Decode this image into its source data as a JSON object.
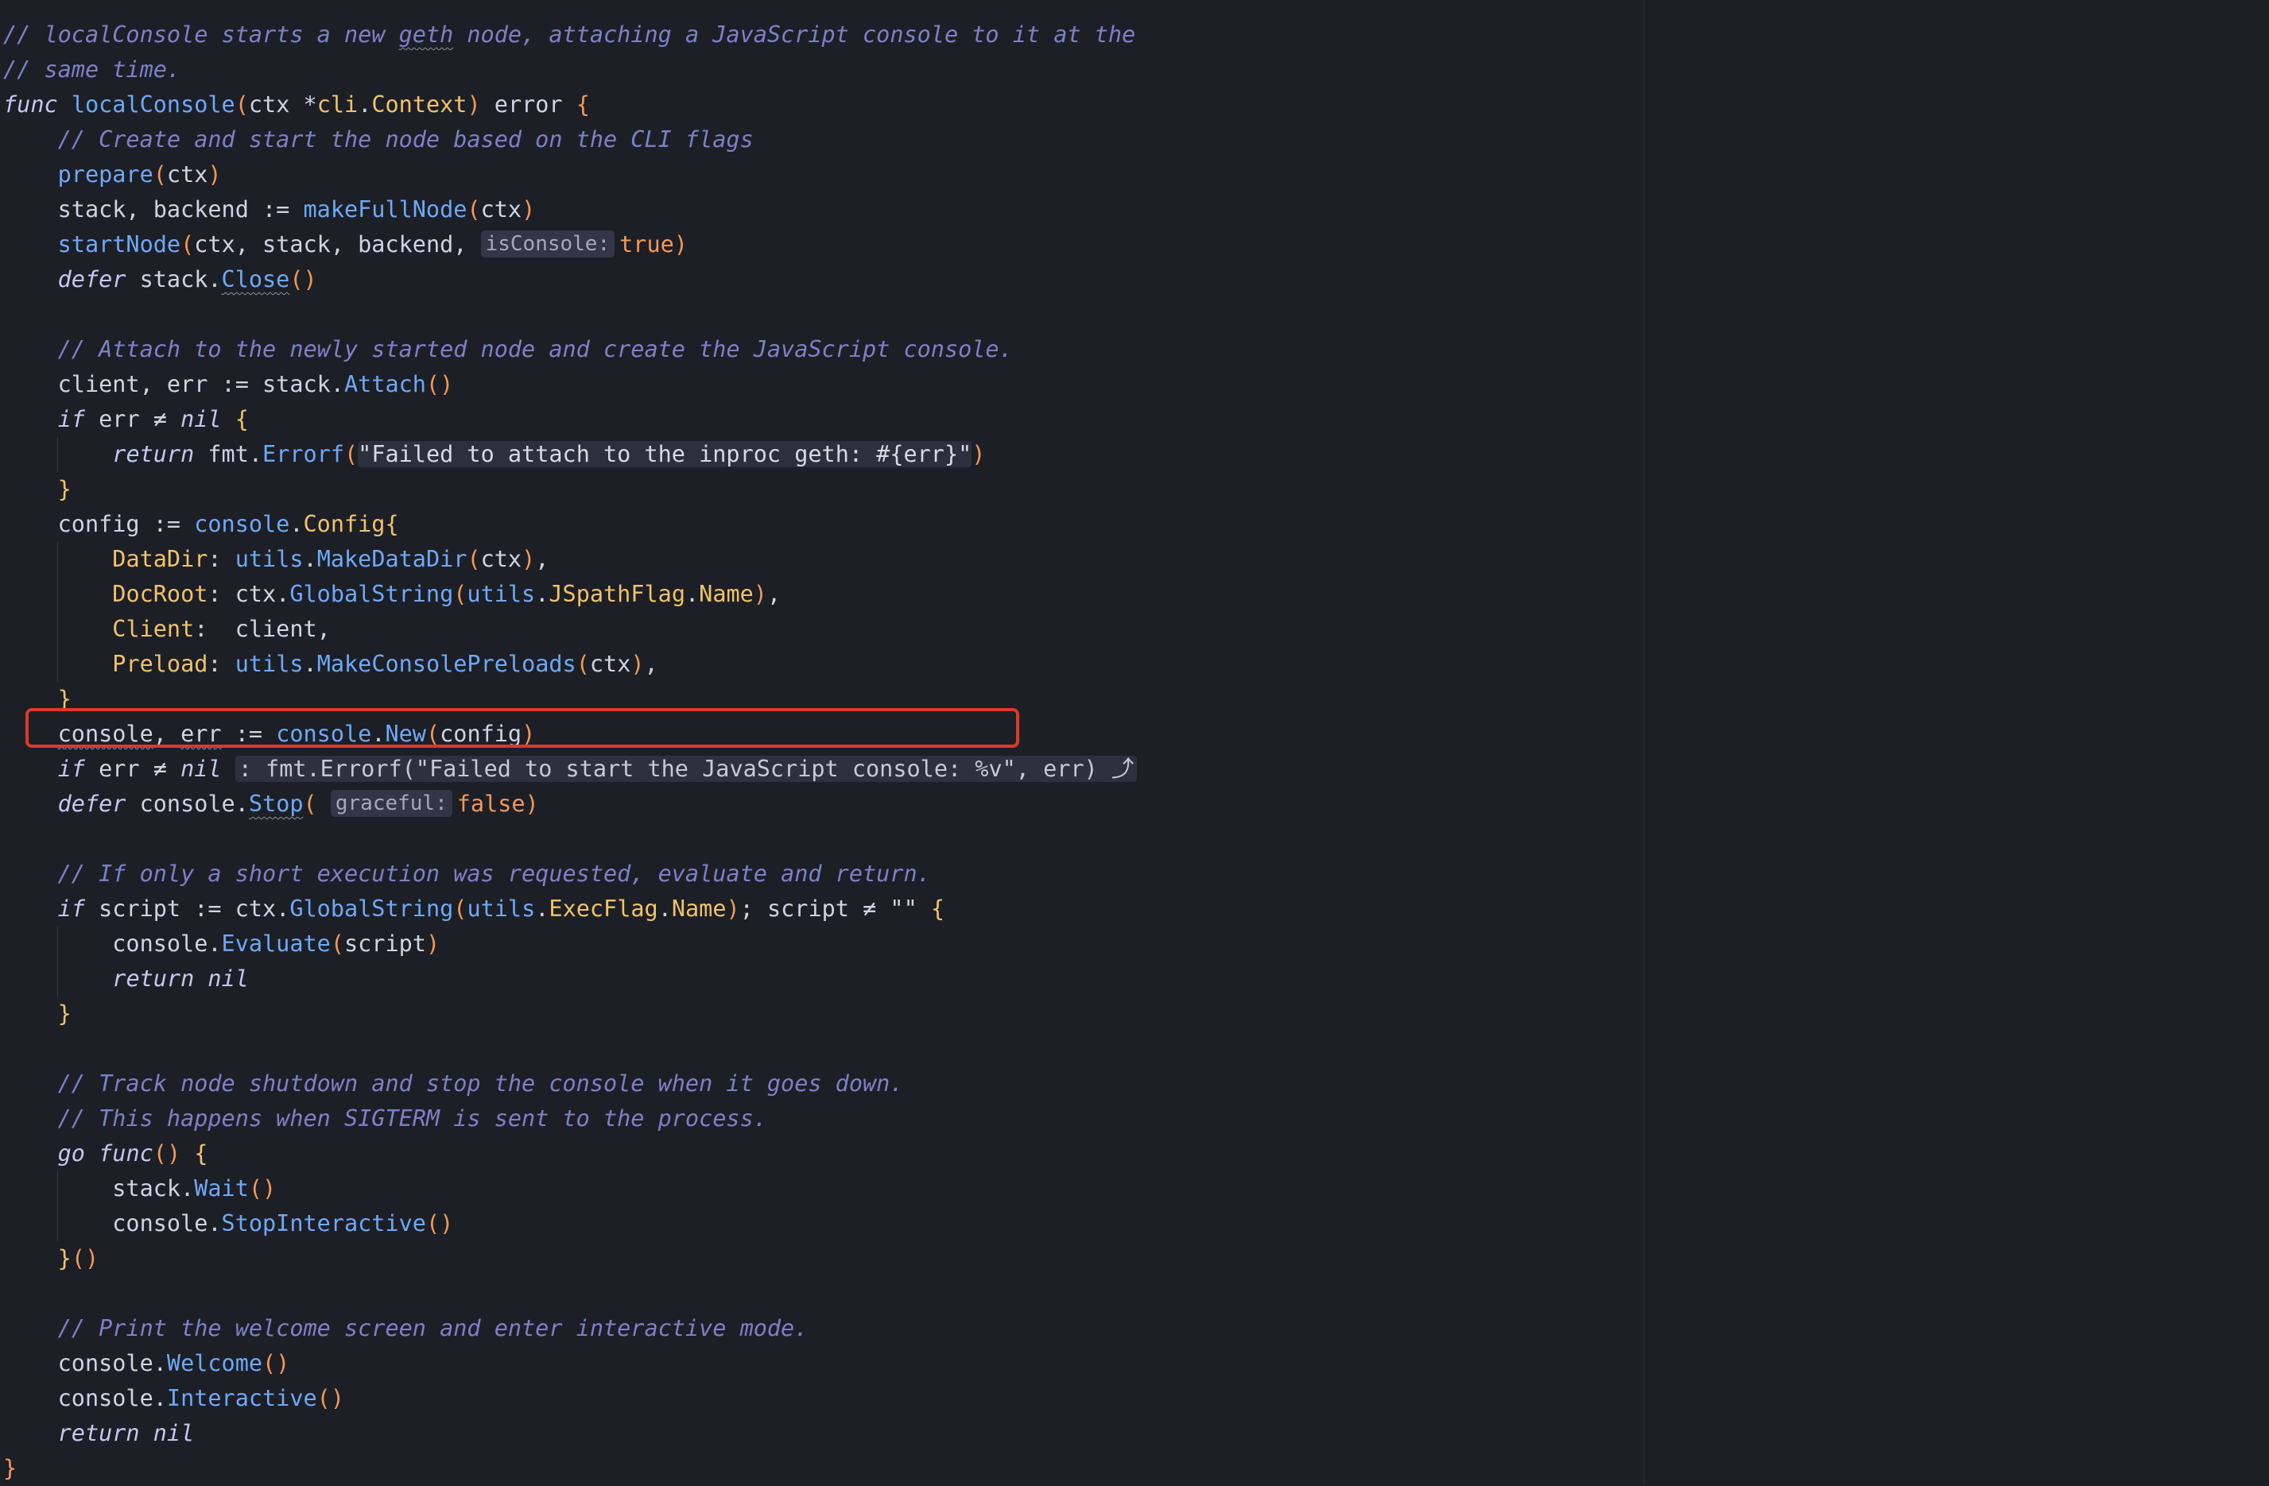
{
  "editor": {
    "lines": [
      [
        [
          "c",
          "// localConsole starts a new "
        ],
        [
          "c sq",
          "geth"
        ],
        [
          "c",
          " node, attaching a JavaScript console to it at the"
        ]
      ],
      [
        [
          "c",
          "// same time."
        ]
      ],
      [
        [
          "k",
          "func"
        ],
        [
          "s",
          " "
        ],
        [
          "f",
          "localConsole"
        ],
        [
          "b",
          "("
        ],
        [
          "s",
          "ctx "
        ],
        [
          "s",
          "*"
        ],
        [
          "t",
          "cli"
        ],
        [
          "s",
          "."
        ],
        [
          "t",
          "Context"
        ],
        [
          "b",
          ")"
        ],
        [
          "s",
          " error "
        ],
        [
          "b",
          "{"
        ]
      ],
      [
        [
          "s",
          "    "
        ],
        [
          "c",
          "// Create and start the node based on the CLI flags"
        ]
      ],
      [
        [
          "s",
          "    "
        ],
        [
          "f",
          "prepare"
        ],
        [
          "b",
          "("
        ],
        [
          "s",
          "ctx"
        ],
        [
          "b",
          ")"
        ]
      ],
      [
        [
          "s",
          "    stack, backend := "
        ],
        [
          "f",
          "makeFullNode"
        ],
        [
          "b",
          "("
        ],
        [
          "s",
          "ctx"
        ],
        [
          "b",
          ")"
        ]
      ],
      [
        [
          "s",
          "    "
        ],
        [
          "f",
          "startNode"
        ],
        [
          "b",
          "("
        ],
        [
          "s",
          "ctx, stack, backend, "
        ],
        [
          "hint",
          "isConsole:"
        ],
        [
          "p",
          "true"
        ],
        [
          "b",
          ")"
        ]
      ],
      [
        [
          "s",
          "    "
        ],
        [
          "k",
          "defer"
        ],
        [
          "s",
          " stack."
        ],
        [
          "f sq",
          "Close"
        ],
        [
          "b",
          "()"
        ]
      ],
      [
        [
          "s",
          ""
        ]
      ],
      [
        [
          "s",
          "    "
        ],
        [
          "c",
          "// Attach to the newly started node and create the JavaScript console."
        ]
      ],
      [
        [
          "s",
          "    client, err := stack."
        ],
        [
          "f",
          "Attach"
        ],
        [
          "b",
          "()"
        ]
      ],
      [
        [
          "s",
          "    "
        ],
        [
          "k",
          "if"
        ],
        [
          "s",
          " err ≠ "
        ],
        [
          "k",
          "nil"
        ],
        [
          "s",
          " "
        ],
        [
          "br",
          "{"
        ]
      ],
      [
        [
          "s",
          "        "
        ],
        [
          "k",
          "return"
        ],
        [
          "s",
          " fmt."
        ],
        [
          "f",
          "Errorf"
        ],
        [
          "b",
          "("
        ],
        [
          "strbox",
          "\"Failed to attach to the inproc geth: #{err}\""
        ],
        [
          "b",
          ")"
        ]
      ],
      [
        [
          "s",
          "    "
        ],
        [
          "br",
          "}"
        ]
      ],
      [
        [
          "s",
          "    config := "
        ],
        [
          "f",
          "console"
        ],
        [
          "s",
          "."
        ],
        [
          "t",
          "Config"
        ],
        [
          "br",
          "{"
        ]
      ],
      [
        [
          "s",
          "        "
        ],
        [
          "t",
          "DataDir"
        ],
        [
          "s",
          ": "
        ],
        [
          "f",
          "utils"
        ],
        [
          "s",
          "."
        ],
        [
          "f",
          "MakeDataDir"
        ],
        [
          "b",
          "("
        ],
        [
          "s",
          "ctx"
        ],
        [
          "b",
          ")"
        ],
        [
          "s",
          ","
        ]
      ],
      [
        [
          "s",
          "        "
        ],
        [
          "t",
          "DocRoot"
        ],
        [
          "s",
          ": ctx."
        ],
        [
          "f",
          "GlobalString"
        ],
        [
          "b",
          "("
        ],
        [
          "f",
          "utils"
        ],
        [
          "s",
          "."
        ],
        [
          "t",
          "JSpathFlag"
        ],
        [
          "s",
          "."
        ],
        [
          "t",
          "Name"
        ],
        [
          "b",
          ")"
        ],
        [
          "s",
          ","
        ]
      ],
      [
        [
          "s",
          "        "
        ],
        [
          "t",
          "Client"
        ],
        [
          "s",
          ":  client,"
        ]
      ],
      [
        [
          "s",
          "        "
        ],
        [
          "t",
          "Preload"
        ],
        [
          "s",
          ": "
        ],
        [
          "f",
          "utils"
        ],
        [
          "s",
          "."
        ],
        [
          "f",
          "MakeConsolePreloads"
        ],
        [
          "b",
          "("
        ],
        [
          "s",
          "ctx"
        ],
        [
          "b",
          ")"
        ],
        [
          "s",
          ","
        ]
      ],
      [
        [
          "s",
          "    "
        ],
        [
          "br",
          "}"
        ]
      ],
      [
        [
          "s",
          "    "
        ],
        [
          "s sq",
          "console"
        ],
        [
          "s",
          ", "
        ],
        [
          "s sq",
          "err"
        ],
        [
          "s",
          " := "
        ],
        [
          "f",
          "console"
        ],
        [
          "s",
          "."
        ],
        [
          "f",
          "New"
        ],
        [
          "b",
          "("
        ],
        [
          "s",
          "config"
        ],
        [
          "b",
          ")"
        ]
      ],
      [
        [
          "s",
          "    "
        ],
        [
          "k",
          "if"
        ],
        [
          "s",
          " err ≠ "
        ],
        [
          "k",
          "nil"
        ],
        [
          "s",
          " "
        ],
        [
          "fold",
          ": fmt.Errorf(\"Failed to start the JavaScript console: %v\", err) ⤴"
        ]
      ],
      [
        [
          "s",
          "    "
        ],
        [
          "k",
          "defer"
        ],
        [
          "s",
          " console."
        ],
        [
          "f sq",
          "Stop"
        ],
        [
          "b",
          "("
        ],
        [
          "s",
          " "
        ],
        [
          "hint",
          "graceful:"
        ],
        [
          "p",
          "false"
        ],
        [
          "b",
          ")"
        ]
      ],
      [
        [
          "s",
          ""
        ]
      ],
      [
        [
          "s",
          "    "
        ],
        [
          "c",
          "// If only a short execution was requested, evaluate and return."
        ]
      ],
      [
        [
          "s",
          "    "
        ],
        [
          "k",
          "if"
        ],
        [
          "s",
          " script := ctx."
        ],
        [
          "f",
          "GlobalString"
        ],
        [
          "b",
          "("
        ],
        [
          "f",
          "utils"
        ],
        [
          "s",
          "."
        ],
        [
          "t",
          "ExecFlag"
        ],
        [
          "s",
          "."
        ],
        [
          "t",
          "Name"
        ],
        [
          "b",
          ")"
        ],
        [
          "s",
          "; script ≠ "
        ],
        [
          "s",
          "\"\""
        ],
        [
          "s",
          " "
        ],
        [
          "br",
          "{"
        ]
      ],
      [
        [
          "s",
          "        console."
        ],
        [
          "f",
          "Evaluate"
        ],
        [
          "b",
          "("
        ],
        [
          "s",
          "script"
        ],
        [
          "b",
          ")"
        ]
      ],
      [
        [
          "s",
          "        "
        ],
        [
          "k",
          "return"
        ],
        [
          "s",
          " "
        ],
        [
          "k",
          "nil"
        ]
      ],
      [
        [
          "s",
          "    "
        ],
        [
          "br",
          "}"
        ]
      ],
      [
        [
          "s",
          ""
        ]
      ],
      [
        [
          "s",
          "    "
        ],
        [
          "c",
          "// Track node shutdown and stop the console when it goes down."
        ]
      ],
      [
        [
          "s",
          "    "
        ],
        [
          "c",
          "// This happens when SIGTERM is sent to the process."
        ]
      ],
      [
        [
          "s",
          "    "
        ],
        [
          "k",
          "go"
        ],
        [
          "s",
          " "
        ],
        [
          "k",
          "func"
        ],
        [
          "b",
          "()"
        ],
        [
          "s",
          " "
        ],
        [
          "br",
          "{"
        ]
      ],
      [
        [
          "s",
          "        stack."
        ],
        [
          "f",
          "Wait"
        ],
        [
          "b",
          "()"
        ]
      ],
      [
        [
          "s",
          "        console."
        ],
        [
          "f",
          "StopInteractive"
        ],
        [
          "b",
          "()"
        ]
      ],
      [
        [
          "s",
          "    "
        ],
        [
          "br",
          "}"
        ],
        [
          "b",
          "()"
        ]
      ],
      [
        [
          "s",
          ""
        ]
      ],
      [
        [
          "s",
          "    "
        ],
        [
          "c",
          "// Print the welcome screen and enter interactive mode."
        ]
      ],
      [
        [
          "s",
          "    console."
        ],
        [
          "f",
          "Welcome"
        ],
        [
          "b",
          "()"
        ]
      ],
      [
        [
          "s",
          "    console."
        ],
        [
          "f",
          "Interactive"
        ],
        [
          "b",
          "()"
        ]
      ],
      [
        [
          "s",
          "    "
        ],
        [
          "k",
          "return"
        ],
        [
          "s",
          " "
        ],
        [
          "k",
          "nil"
        ]
      ],
      [
        [
          "b",
          "}"
        ]
      ]
    ]
  },
  "theme": {
    "background": "#1d1f27",
    "highlight_border": "#d93a2b"
  }
}
